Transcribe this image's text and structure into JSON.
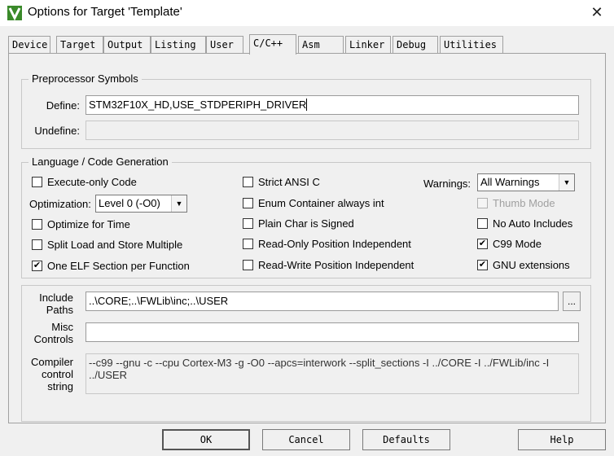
{
  "window": {
    "title": "Options for Target 'Template'",
    "icon": "uvision-icon",
    "close": "✕"
  },
  "tabs": [
    {
      "label": "Device"
    },
    {
      "label": "Target"
    },
    {
      "label": "Output"
    },
    {
      "label": "Listing"
    },
    {
      "label": "User"
    },
    {
      "label": "C/C++",
      "active": true
    },
    {
      "label": "Asm"
    },
    {
      "label": "Linker"
    },
    {
      "label": "Debug"
    },
    {
      "label": "Utilities"
    }
  ],
  "preprocessor": {
    "title": "Preprocessor Symbols",
    "define_label": "Define:",
    "define_value": "STM32F10X_HD,USE_STDPERIPH_DRIVER",
    "undefine_label": "Undefine:",
    "undefine_value": ""
  },
  "language": {
    "title": "Language / Code Generation",
    "execute_only": {
      "label": "Execute-only Code",
      "checked": false
    },
    "optimization_label": "Optimization:",
    "optimization_value": "Level 0 (-O0)",
    "optimize_time": {
      "label": "Optimize for Time",
      "checked": false
    },
    "split_load": {
      "label": "Split Load and Store Multiple",
      "checked": false
    },
    "one_elf": {
      "label": "One ELF Section per Function",
      "checked": true
    },
    "strict_ansi": {
      "label": "Strict ANSI C",
      "checked": false
    },
    "enum_container": {
      "label": "Enum Container always int",
      "checked": false
    },
    "plain_char": {
      "label": "Plain Char is Signed",
      "checked": false
    },
    "ro_pos_indep": {
      "label": "Read-Only Position Independent",
      "checked": false
    },
    "rw_pos_indep": {
      "label": "Read-Write Position Independent",
      "checked": false
    },
    "warnings_label": "Warnings:",
    "warnings_value": "All Warnings",
    "thumb_mode": {
      "label": "Thumb Mode",
      "checked": false,
      "disabled": true
    },
    "no_auto_includes": {
      "label": "No Auto Includes",
      "checked": false
    },
    "c99_mode": {
      "label": "C99 Mode",
      "checked": true
    },
    "gnu_extensions": {
      "label": "GNU extensions",
      "checked": true
    }
  },
  "paths": {
    "include_label_1": "Include",
    "include_label_2": "Paths",
    "include_value": "..\\CORE;..\\FWLib\\inc;..\\USER",
    "browse_label": "...",
    "misc_label_1": "Misc",
    "misc_label_2": "Controls",
    "misc_value": "",
    "compiler_label_1": "Compiler",
    "compiler_label_2": "control",
    "compiler_label_3": "string",
    "compiler_value": "--c99 --gnu -c --cpu Cortex-M3 -g -O0 --apcs=interwork --split_sections -I ../CORE -I ../FWLib/inc -I ../USER"
  },
  "buttons": {
    "ok": "OK",
    "cancel": "Cancel",
    "defaults": "Defaults",
    "help": "Help"
  },
  "check_glyph": "✔"
}
